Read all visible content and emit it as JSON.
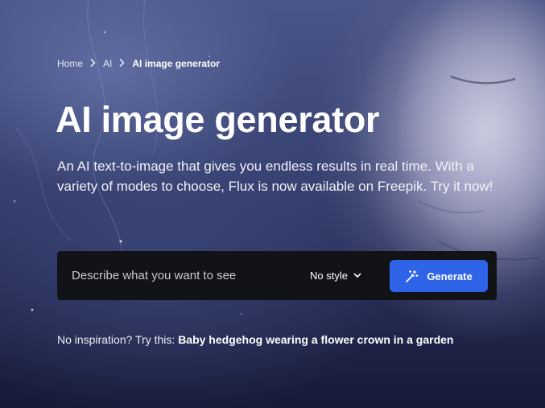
{
  "breadcrumb": {
    "items": [
      {
        "label": "Home"
      },
      {
        "label": "AI"
      },
      {
        "label": "AI image generator"
      }
    ]
  },
  "hero": {
    "title": "AI image generator",
    "subtitle": "An AI text-to-image that gives you endless results in real time. With a variety of modes to choose, Flux is now available on Freepik. Try it now!"
  },
  "search": {
    "placeholder": "Describe what you want to see",
    "style_label": "No style",
    "generate_label": "Generate"
  },
  "inspiration": {
    "prefix": "No inspiration? Try this:",
    "suggestion": "Baby hedgehog wearing a flower crown in a garden"
  },
  "icons": {
    "separator": "chevron-right-icon",
    "dropdown": "chevron-down-icon",
    "generate": "magic-wand-icon"
  },
  "colors": {
    "accent": "#2f63e8",
    "bar_background": "#121317"
  }
}
